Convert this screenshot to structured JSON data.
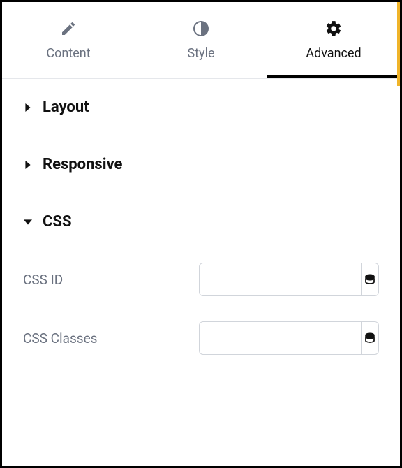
{
  "tabs": {
    "content": {
      "label": "Content"
    },
    "style": {
      "label": "Style"
    },
    "advanced": {
      "label": "Advanced",
      "active": true
    }
  },
  "sections": {
    "layout": {
      "title": "Layout",
      "expanded": false
    },
    "responsive": {
      "title": "Responsive",
      "expanded": false
    },
    "css": {
      "title": "CSS",
      "expanded": true
    }
  },
  "css": {
    "id_label": "CSS ID",
    "id_value": "",
    "classes_label": "CSS Classes",
    "classes_value": ""
  }
}
